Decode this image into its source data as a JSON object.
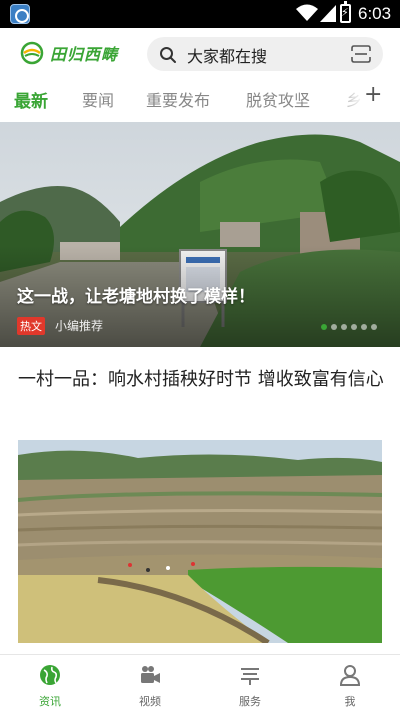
{
  "status_bar": {
    "time": "6:03"
  },
  "header": {
    "logo_text": "田归西畴",
    "search_text": "大家都在搜"
  },
  "tabs": [
    {
      "label": "最新",
      "active": true
    },
    {
      "label": "要闻",
      "active": false
    },
    {
      "label": "重要发布",
      "active": false
    },
    {
      "label": "脱贫攻坚",
      "active": false
    },
    {
      "label": "乡",
      "active": false
    }
  ],
  "banner": {
    "title": "这一战，让老塘地村换了模样！",
    "tag": "热文",
    "source": "小编推荐",
    "slide_index": 1,
    "slide_count": 6
  },
  "article": {
    "title": "一村一品：响水村插秧好时节 增收致富有信心"
  },
  "bottom_nav": [
    {
      "label": "资讯",
      "icon": "globe-icon",
      "active": true
    },
    {
      "label": "视频",
      "icon": "video-camera-icon",
      "active": false
    },
    {
      "label": "服务",
      "icon": "service-list-icon",
      "active": false
    },
    {
      "label": "我",
      "icon": "user-icon",
      "active": false
    }
  ],
  "colors": {
    "accent": "#3aa535",
    "hot_tag": "#e0382b"
  }
}
